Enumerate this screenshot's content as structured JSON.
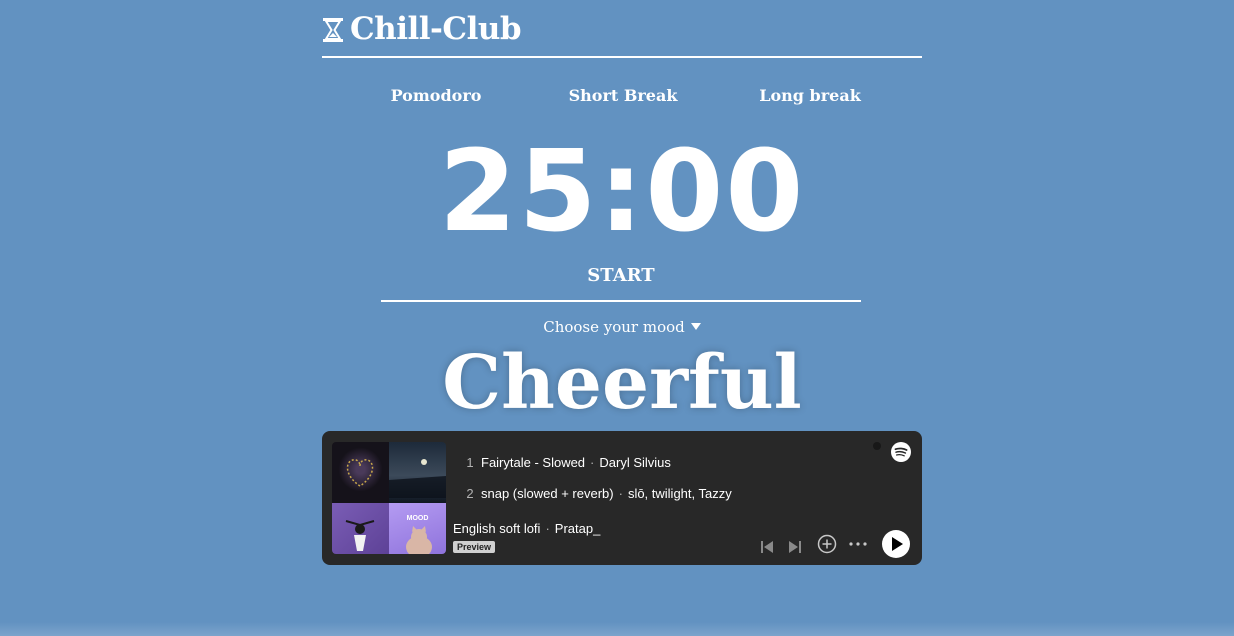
{
  "app": {
    "title": "Chill-Club",
    "logo_icon": "hourglass-icon"
  },
  "modes": [
    {
      "label": "Pomodoro"
    },
    {
      "label": "Short Break"
    },
    {
      "label": "Long break"
    }
  ],
  "timer": {
    "display": "25:00"
  },
  "start_button": {
    "label": "START"
  },
  "mood": {
    "select_label": "Choose your mood",
    "current": "Cheerful"
  },
  "player": {
    "tracks": [
      {
        "number": "1",
        "title": "Fairytale - Slowed",
        "artist": "Daryl Silvius"
      },
      {
        "number": "2",
        "title": "snap (slowed + reverb)",
        "artist": "slō, twilight, Tazzy"
      }
    ],
    "playlist": {
      "name": "English soft lofi",
      "owner": "Pratap_"
    },
    "badge": "Preview",
    "cover_text": "MOOD",
    "icons": {
      "logo": "spotify-icon",
      "previous": "skip-back-icon",
      "next": "skip-forward-icon",
      "add": "plus-circle-icon",
      "more": "more-icon",
      "play": "play-icon"
    },
    "colors": {
      "background": "#282828",
      "accent": "#ffffff"
    }
  },
  "colors": {
    "page_background": "#6292c1",
    "text": "#ffffff"
  }
}
